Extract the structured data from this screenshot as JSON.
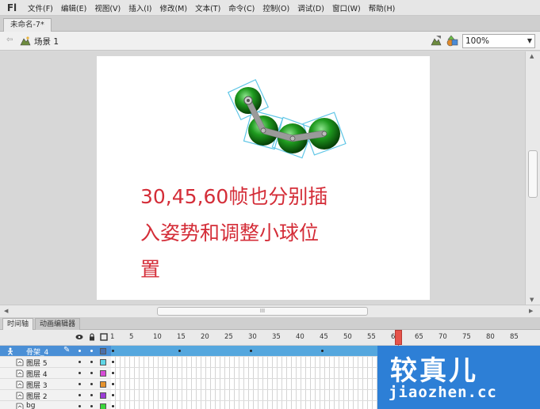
{
  "app": {
    "logo": "Fl"
  },
  "menu": {
    "items": [
      "文件(F)",
      "编辑(E)",
      "视图(V)",
      "插入(I)",
      "修改(M)",
      "文本(T)",
      "命令(C)",
      "控制(O)",
      "调试(D)",
      "窗口(W)",
      "帮助(H)"
    ]
  },
  "document": {
    "tab_title": "未命名-7*"
  },
  "scene": {
    "label": "场景 1"
  },
  "zoom": {
    "value": "100%"
  },
  "stage": {
    "caption_lines": [
      "30,45,60帧也分别插",
      "入姿势和调整小球位",
      "置"
    ]
  },
  "colors": {
    "caption": "#d42d38",
    "selected_layer": "#4a8fd6",
    "ball": "#1f9b1f",
    "watermark_bg": "#2d7fd6"
  },
  "hscroll": {
    "grip": "III"
  },
  "panels": {
    "tabs": [
      "时间轴",
      "动画编辑器"
    ]
  },
  "timeline": {
    "ruler": [
      "1",
      "5",
      "10",
      "15",
      "20",
      "25",
      "30",
      "35",
      "40",
      "45",
      "50",
      "55",
      "60",
      "65",
      "70",
      "75",
      "80",
      "85"
    ],
    "current_frame": "60",
    "layers": [
      {
        "name": "骨架_4",
        "selected": true,
        "swatch": "#4b6ea9",
        "icon": "armature-layer-icon"
      },
      {
        "name": "图层 5",
        "selected": false,
        "swatch": "#5fd6e6",
        "icon": "layer-icon"
      },
      {
        "name": "图层 4",
        "selected": false,
        "swatch": "#d64bd6",
        "icon": "layer-icon"
      },
      {
        "name": "图层 3",
        "selected": false,
        "swatch": "#e6922d",
        "icon": "layer-icon"
      },
      {
        "name": "图层 2",
        "selected": false,
        "swatch": "#9b3bd6",
        "icon": "layer-icon"
      },
      {
        "name": "bg",
        "selected": false,
        "swatch": "#3bd63b",
        "icon": "layer-icon"
      }
    ]
  },
  "watermark": {
    "title": "较真儿",
    "url": "jiaozhen.cc"
  }
}
